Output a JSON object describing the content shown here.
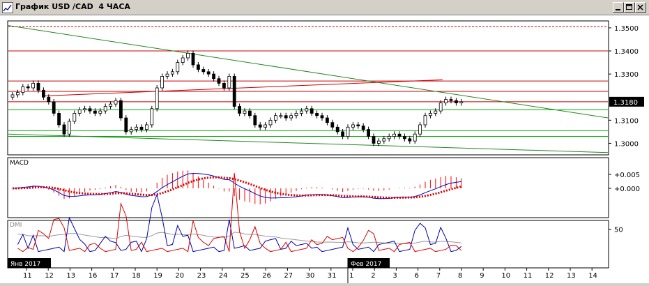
{
  "window": {
    "title": "График USD /CAD  4 ЧАСА",
    "min_icon": "minimize-icon",
    "max_icon": "maximize-icon",
    "close_icon": "close-icon"
  },
  "colors": {
    "bull": "#ffffff",
    "bear": "#000000",
    "resistance": "#cc0000",
    "support": "#00aa00",
    "trend": "#228822",
    "macd": "#0000cc",
    "signal": "#dd0000",
    "histogram": "#ff0000",
    "dmi_minus": "#dd0000",
    "dmi_plus": "#0000aa",
    "adx": "#999999"
  },
  "price_panel": {
    "current_price_label": "1.3180",
    "y_ticks": [
      "1.3500",
      "1.3400",
      "1.3300",
      "1.3100",
      "1.3000"
    ]
  },
  "macd_panel": {
    "label": "MACD",
    "y_ticks": [
      "+0.005",
      "+0.000"
    ]
  },
  "dmi_panel": {
    "label": "DMI",
    "y_ticks": [
      "50"
    ]
  },
  "x_axis": {
    "ticks": [
      "11",
      "12",
      "13",
      "16",
      "17",
      "18",
      "19",
      "20",
      "23",
      "24",
      "25",
      "26",
      "27",
      "30",
      "31",
      "1",
      "2",
      "3",
      "6",
      "7",
      "8",
      "9",
      "10",
      "11",
      "12",
      "13",
      "14"
    ],
    "month_labels": [
      "Янв 2017",
      "Фев 2017"
    ]
  },
  "chart_data": {
    "type": "candlestick",
    "timeframe": "4 ЧАСА",
    "symbol": "USD /CAD",
    "ylim": [
      1.295,
      1.353
    ],
    "horizontal_levels": [
      1.3505,
      1.34,
      1.327,
      1.3225,
      1.318,
      1.3145,
      1.3055,
      1.303
    ],
    "close": [
      1.321,
      1.322,
      1.3245,
      1.324,
      1.326,
      1.323,
      1.32,
      1.318,
      1.313,
      1.308,
      1.304,
      1.3095,
      1.313,
      1.3145,
      1.315,
      1.314,
      1.313,
      1.314,
      1.316,
      1.317,
      1.3185,
      1.311,
      1.305,
      1.306,
      1.307,
      1.306,
      1.308,
      1.315,
      1.324,
      1.329,
      1.33,
      1.331,
      1.335,
      1.337,
      1.339,
      1.334,
      1.332,
      1.331,
      1.33,
      1.328,
      1.326,
      1.324,
      1.329,
      1.316,
      1.313,
      1.314,
      1.312,
      1.308,
      1.307,
      1.308,
      1.31,
      1.312,
      1.312,
      1.311,
      1.312,
      1.313,
      1.314,
      1.315,
      1.313,
      1.312,
      1.311,
      1.309,
      1.307,
      1.305,
      1.303,
      1.307,
      1.308,
      1.3075,
      1.306,
      1.303,
      1.3,
      1.301,
      1.302,
      1.303,
      1.304,
      1.303,
      1.302,
      1.301,
      1.304,
      1.308,
      1.312,
      1.313,
      1.314,
      1.3175,
      1.319,
      1.3185,
      1.3175,
      1.318
    ]
  }
}
